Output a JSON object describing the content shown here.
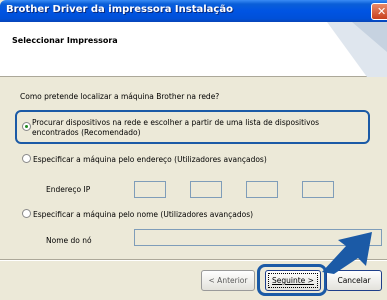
{
  "window": {
    "title": "Brother Driver da impressora Instalação"
  },
  "header": {
    "title": "Seleccionar Impressora"
  },
  "main": {
    "question": "Como pretende localizar a máquina Brother na rede?",
    "option1": {
      "line1": "Procurar dispositivos na rede e escolher a partir de uma lista de dispositivos",
      "line2": "encontrados (Recomendado)",
      "selected": true
    },
    "option2": {
      "label": "Especificar a máquina pelo endereço (Utilizadores avançados)",
      "selected": false,
      "ip_label": "Endereço IP"
    },
    "option3": {
      "label": "Especificar a máquina pelo nome (Utilizadores avançados)",
      "selected": false,
      "node_label": "Nome do nó"
    }
  },
  "footer": {
    "back_label": "< Anterior",
    "next_label": "Seguinte >",
    "cancel_label": "Cancelar"
  },
  "colors": {
    "highlight": "#1b5aa6",
    "titlebar": "#0054e3"
  }
}
